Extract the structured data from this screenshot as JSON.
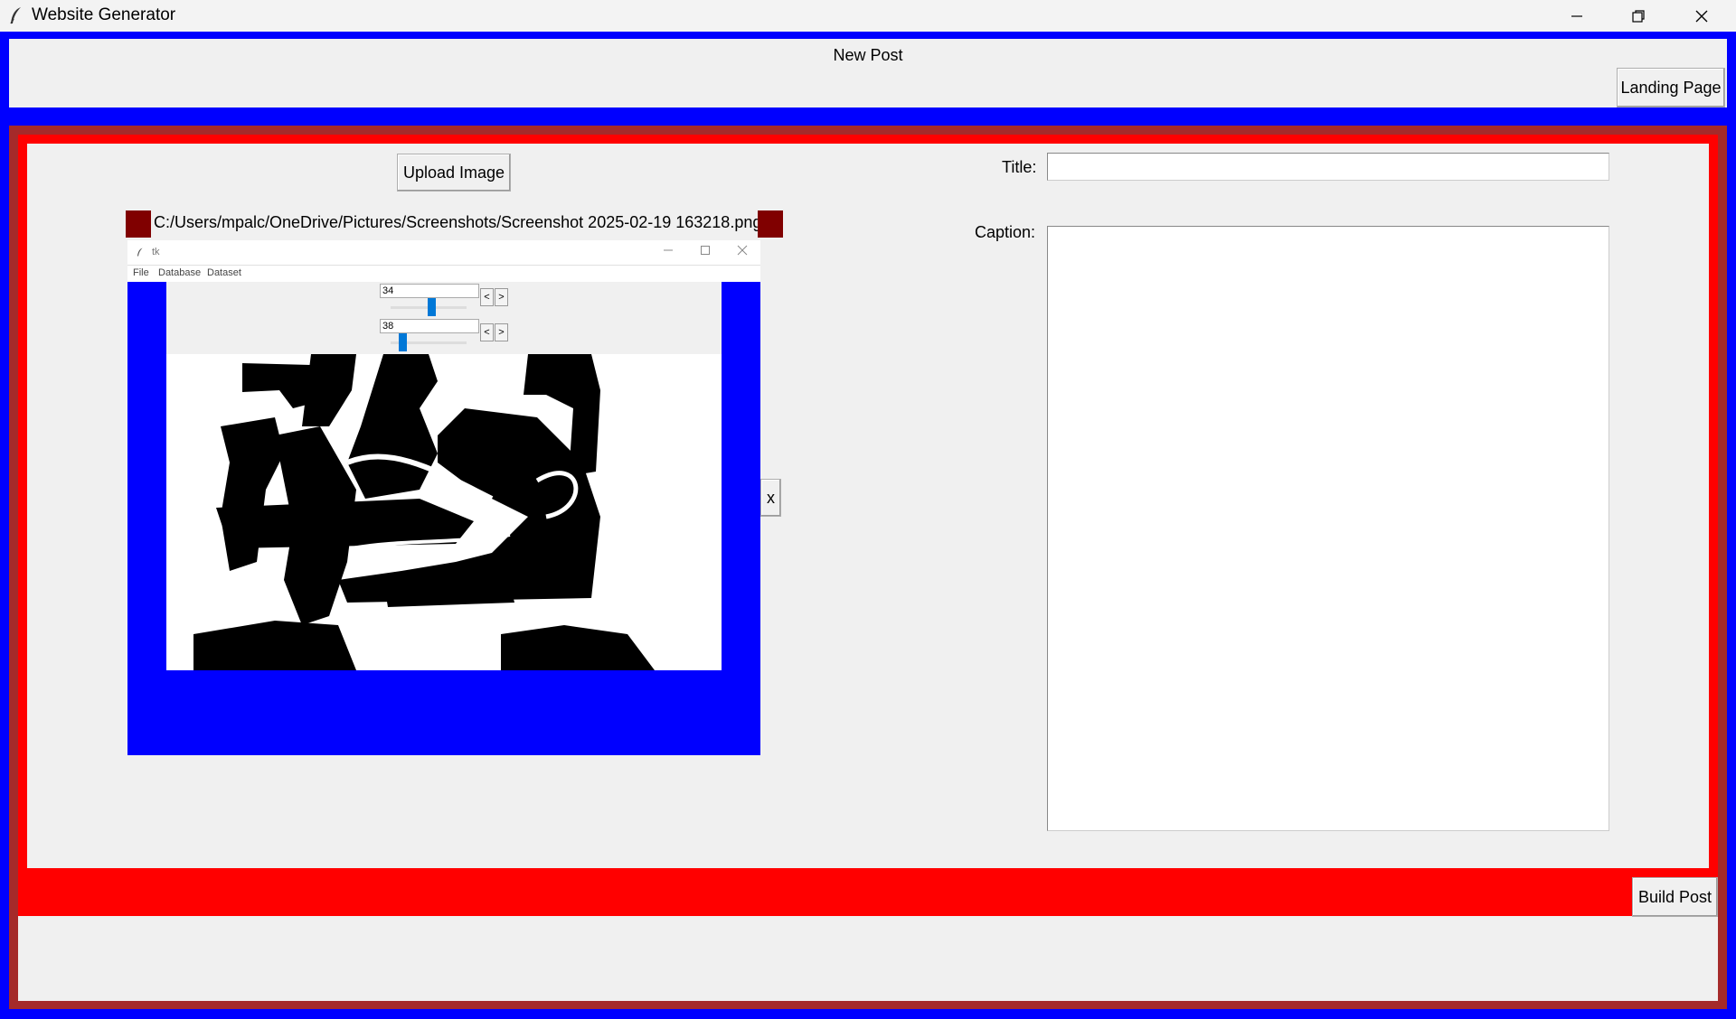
{
  "window": {
    "title": "Website Generator",
    "icon": "feather-icon",
    "controls": [
      "minimize-icon",
      "restore-icon",
      "close-icon"
    ]
  },
  "header": {
    "title": "New Post",
    "landing_button": "Landing Page"
  },
  "upload": {
    "button_label": "Upload Image",
    "file_path": "C:/Users/mpalc/OneDrive/Pictures/Screenshots/Screenshot 2025-02-19 163218.png",
    "remove_label": "x"
  },
  "preview": {
    "window_title": "tk",
    "menu": [
      "File",
      "Database",
      "Dataset"
    ],
    "slider1_value": "34",
    "slider2_value": "38",
    "slider1_level": 0.54,
    "slider2_level": 0.16,
    "prev_label": "<",
    "next_label": ">"
  },
  "form": {
    "title_label": "Title:",
    "title_value": "",
    "caption_label": "Caption:",
    "caption_value": ""
  },
  "footer": {
    "build_button": "Build Post"
  },
  "colors": {
    "frame_blue": "#0000ff",
    "frame_red": "#ff0000",
    "frame_brown": "#a52a2a",
    "marker_maroon": "#800000",
    "panel_gray": "#f0f0f0"
  }
}
